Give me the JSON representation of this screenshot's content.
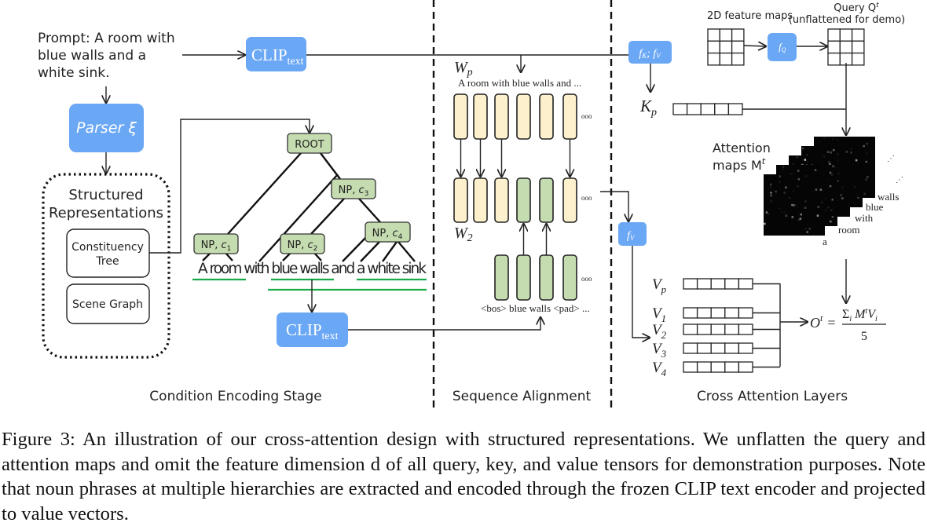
{
  "prompt": {
    "lines": [
      "Prompt: A room with",
      "blue walls and a",
      "white sink."
    ]
  },
  "clip_label": "CLIP",
  "clip_sub": "text",
  "parser": {
    "label": "Parser ξ"
  },
  "structured": {
    "title_lines": [
      "Structured",
      "Representations"
    ],
    "items": [
      [
        "Constituency",
        "Tree"
      ],
      [
        "Scene Graph"
      ]
    ]
  },
  "tree": {
    "root": "ROOT",
    "np_label": "NP, ",
    "nodes": [
      "c",
      "c",
      "c",
      "c"
    ],
    "node_subs": [
      "1",
      "2",
      "3",
      "4"
    ],
    "sentence": "A room with blue walls and a white sink"
  },
  "alignment": {
    "wp": "W",
    "wp_sub": "p",
    "w2": "W",
    "w2_sub": "2",
    "prompt_tokens": "A room with blue walls and ...",
    "np_tokens": "<bos> blue walls <pad> ...",
    "ellipsis": "ooo",
    "colors": {
      "prompt": "#fdf0cc",
      "noun_phrase": "#c5dcb0"
    }
  },
  "cross": {
    "fkv": "f",
    "fkv_sub1": "K",
    "fkv_mid": "; f",
    "fkv_sub2": "V",
    "fq": "f",
    "fq_sub": "Q",
    "fv": "f",
    "fv_sub": "V",
    "feature_maps_label": "2D feature maps",
    "query_label": "Query Q",
    "query_sup": "t",
    "query_note": "(unflattened for demo)",
    "kp": "K",
    "kp_sub": "p",
    "attention_lines": [
      "Attention",
      "maps M"
    ],
    "attention_sup": "t",
    "map_tokens": [
      "a",
      "room",
      "with",
      "blue",
      "walls"
    ],
    "values": [
      {
        "v": "V",
        "sub": "p"
      },
      {
        "v": "V",
        "sub": "1"
      },
      {
        "v": "V",
        "sub": "2"
      },
      {
        "v": "V",
        "sub": "3"
      },
      {
        "v": "V",
        "sub": "4"
      }
    ],
    "output": "O",
    "output_sup": "t",
    "equals": "=",
    "numerator": "Σ",
    "num_i": "i",
    "num_m": " M",
    "num_t": "t",
    "num_v": "V",
    "num_vi": "i",
    "denominator": "5"
  },
  "stages": [
    "Condition Encoding Stage",
    "Sequence Alignment",
    "Cross Attention Layers"
  ],
  "colors": {
    "module_blue": "#6aa7f4",
    "underline_green": "#1aaa4a"
  },
  "caption": "Figure 3: An illustration of our cross-attention design with structured representations. We unflatten the query and attention maps and omit the feature dimension d of all query, key, and value tensors for demonstration purposes. Note that noun phrases at multiple hierarchies are extracted and encoded through the frozen CLIP text encoder and projected to value vectors."
}
